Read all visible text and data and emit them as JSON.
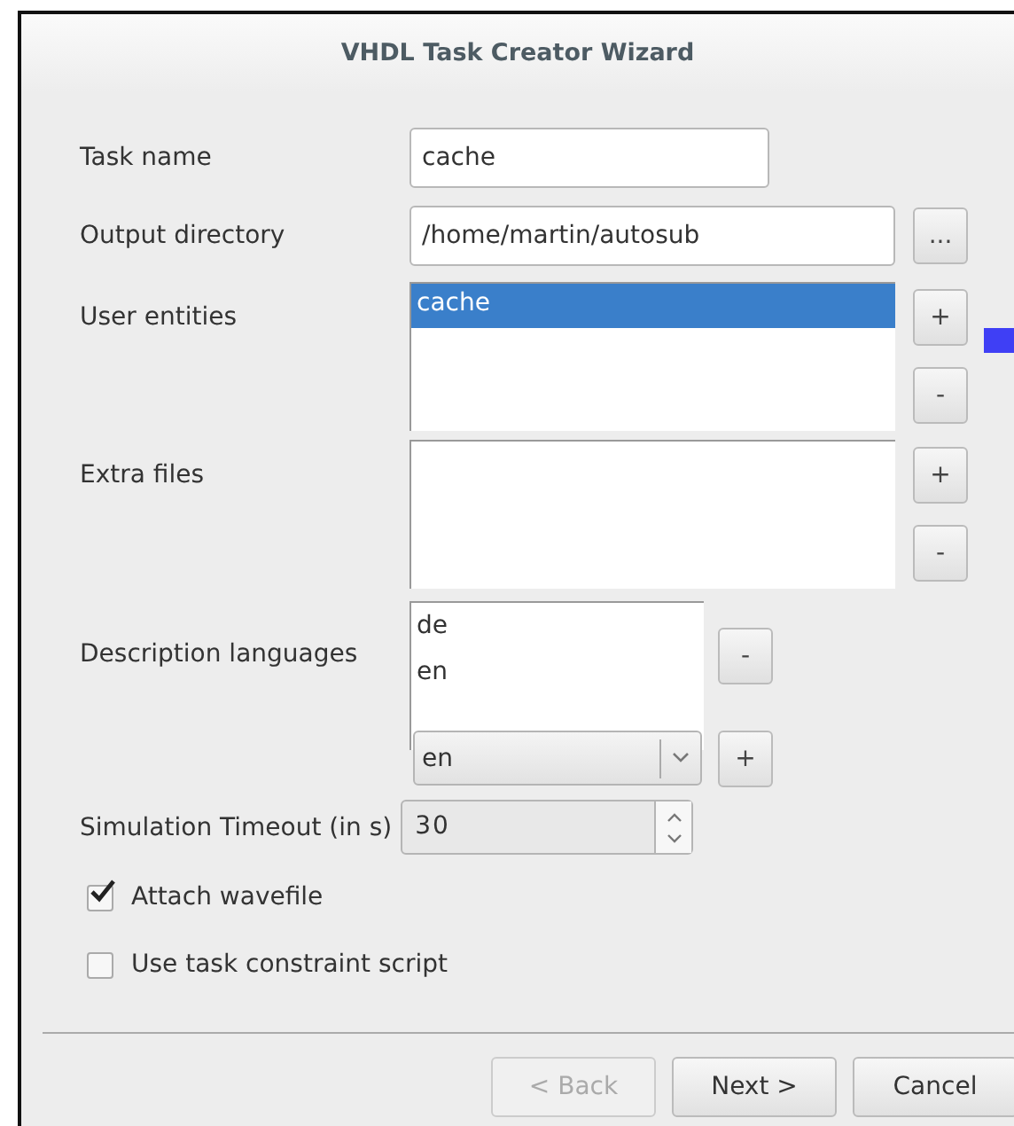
{
  "window": {
    "title": "VHDL Task Creator Wizard"
  },
  "task_name": {
    "label": "Task name",
    "value": "cache"
  },
  "output_directory": {
    "label": "Output directory",
    "value": "/home/martin/autosub",
    "browse_button": "..."
  },
  "user_entities": {
    "label": "User entities",
    "items": [
      {
        "text": "cache",
        "selected": true
      }
    ],
    "add_button": "+",
    "remove_button": "-"
  },
  "extra_files": {
    "label": "Extra files",
    "add_button": "+",
    "remove_button": "-"
  },
  "description_languages": {
    "label": "Description languages",
    "items": [
      {
        "text": "de",
        "selected": false
      },
      {
        "text": "en",
        "selected": false
      }
    ],
    "remove_button": "-",
    "combo_value": "en",
    "add_button": "+"
  },
  "simulation_timeout": {
    "label": "Simulation Timeout (in s)",
    "value": "30"
  },
  "checkboxes": [
    {
      "label": "Attach wavefile",
      "checked": true
    },
    {
      "label": "Use task constraint script",
      "checked": false
    }
  ],
  "buttons": [
    {
      "label": "< Back",
      "disabled": true
    },
    {
      "label": "Next >",
      "disabled": false
    },
    {
      "label": "Cancel",
      "disabled": false
    }
  ]
}
